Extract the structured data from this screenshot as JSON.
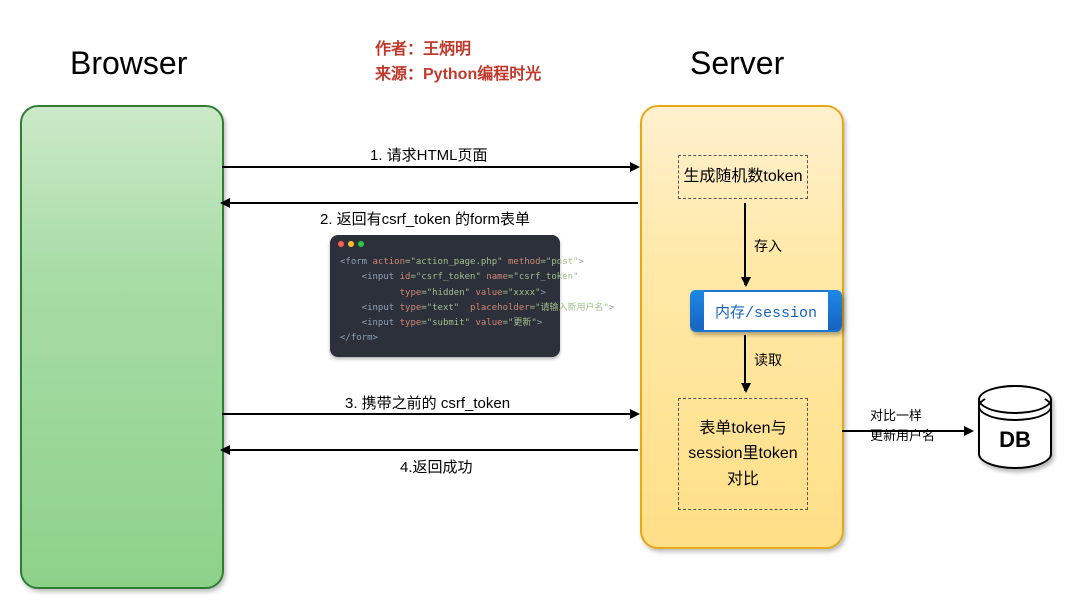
{
  "titles": {
    "browser": "Browser",
    "server": "Server"
  },
  "attribution": {
    "author": "作者：王炳明",
    "source": "来源：Python编程时光"
  },
  "arrows": {
    "step1": "1. 请求HTML页面",
    "step2": "2. 返回有csrf_token 的form表单",
    "step3": "3. 携带之前的 csrf_token",
    "step4": "4.返回成功"
  },
  "server": {
    "generate_token": "生成随机数token",
    "save_label": "存入",
    "session_label": "内存/session",
    "read_label": "读取",
    "compare_line1": "表单token与",
    "compare_line2": "session里token",
    "compare_line3": "对比"
  },
  "db": {
    "label": "DB",
    "note_line1": "对比一样",
    "note_line2": "更新用户名"
  },
  "code": {
    "l1_open": "<form",
    "l1_a1": " action",
    "l1_v1": "=\"action_page.php\"",
    "l1_a2": " method",
    "l1_v2": "=\"post\"",
    "l1_close": ">",
    "l2_open": "    <input",
    "l2_a1": " id",
    "l2_v1": "=\"csrf_token\"",
    "l2_a2": " name",
    "l2_v2": "=\"csrf_token\"",
    "l3_pad": "           ",
    "l3_a1": "type",
    "l3_v1": "=\"hidden\"",
    "l3_a2": " value",
    "l3_v2": "=\"xxxx\"",
    "l3_close": ">",
    "l4_open": "    <input",
    "l4_a1": " type",
    "l4_v1": "=\"text\"",
    "l4_a2": "  placeholder",
    "l4_v2": "=\"请输入新用户名\"",
    "l4_close": ">",
    "l5_open": "    <input",
    "l5_a1": " type",
    "l5_v1": "=\"submit\"",
    "l5_a2": " value",
    "l5_v2": "=\"更新\"",
    "l5_close": ">",
    "l6": "</form>"
  }
}
